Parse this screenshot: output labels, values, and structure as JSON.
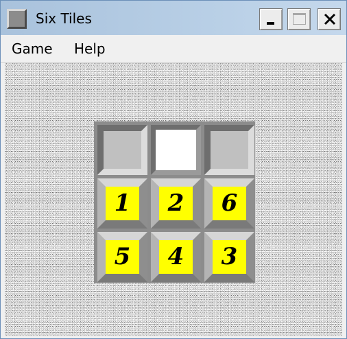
{
  "window": {
    "title": "Six Tiles",
    "accent_color": "#b8cfe6"
  },
  "title_buttons": {
    "minimize_icon": "minimize-icon",
    "maximize_icon": "maximize-icon",
    "close_icon": "close-icon"
  },
  "menu": {
    "items": [
      {
        "label": "Game"
      },
      {
        "label": "Help"
      }
    ]
  },
  "board": {
    "rows": 3,
    "cols": 3,
    "tile_color": "#ffff00",
    "cells": [
      {
        "row": 0,
        "col": 0,
        "kind": "empty",
        "label": ""
      },
      {
        "row": 0,
        "col": 1,
        "kind": "hole",
        "label": ""
      },
      {
        "row": 0,
        "col": 2,
        "kind": "empty",
        "label": ""
      },
      {
        "row": 1,
        "col": 0,
        "kind": "tile",
        "label": "1"
      },
      {
        "row": 1,
        "col": 1,
        "kind": "tile",
        "label": "2"
      },
      {
        "row": 1,
        "col": 2,
        "kind": "tile",
        "label": "6"
      },
      {
        "row": 2,
        "col": 0,
        "kind": "tile",
        "label": "5"
      },
      {
        "row": 2,
        "col": 1,
        "kind": "tile",
        "label": "4"
      },
      {
        "row": 2,
        "col": 2,
        "kind": "tile",
        "label": "3"
      }
    ]
  }
}
